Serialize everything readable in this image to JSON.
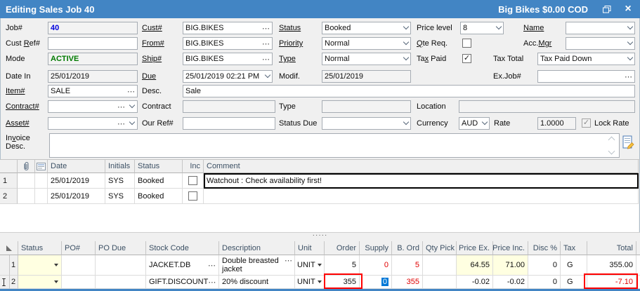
{
  "titlebar": {
    "title": "Editing Sales Job 40",
    "right_text": "Big Bikes $0.00 COD"
  },
  "icons": {
    "close": "×",
    "ellipsis": "⋯",
    "splitter_dots": "·····",
    "check": "✓"
  },
  "labels": {
    "job": {
      "pre": "Job#",
      "u": "",
      "post": ""
    },
    "cust_ref": {
      "pre": "Cust ",
      "u": "R",
      "post": "ef#"
    },
    "mode": {
      "pre": "Mode",
      "u": "",
      "post": ""
    },
    "date_in": {
      "pre": "Date In",
      "u": "",
      "post": ""
    },
    "item": {
      "pre": "",
      "u": "Item#",
      "post": ""
    },
    "cust": {
      "pre": "",
      "u": "Cust#",
      "post": ""
    },
    "from": {
      "pre": "",
      "u": "From#",
      "post": ""
    },
    "ship": {
      "pre": "",
      "u": "Ship#",
      "post": ""
    },
    "due": {
      "pre": "",
      "u": "Due",
      "post": ""
    },
    "desc": {
      "pre": "Desc.",
      "u": "",
      "post": ""
    },
    "status": {
      "pre": "",
      "u": "Status",
      "post": ""
    },
    "priority": {
      "pre": "",
      "u": "Priority",
      "post": ""
    },
    "type": {
      "pre": "",
      "u": "Type",
      "post": ""
    },
    "modif": {
      "pre": "Modif.",
      "u": "",
      "post": ""
    },
    "price_level": {
      "pre": "Price level",
      "u": "",
      "post": ""
    },
    "qte_req": {
      "pre": "",
      "u": "Q",
      "post": "te Req."
    },
    "tax_paid": {
      "pre": "Ta",
      "u": "x",
      "post": " Paid"
    },
    "name": {
      "pre": "",
      "u": "Name",
      "post": ""
    },
    "acc_mgr": {
      "pre": "Acc.",
      "u": "Mgr",
      "post": ""
    },
    "tax_total": {
      "pre": "Tax Total",
      "u": "",
      "post": ""
    },
    "ex_job": {
      "pre": "Ex.Job#",
      "u": "",
      "post": ""
    },
    "contract_no": {
      "pre": "",
      "u": "Contract#",
      "post": ""
    },
    "contract": {
      "pre": "Contract",
      "u": "",
      "post": ""
    },
    "type2": {
      "pre": "Type",
      "u": "",
      "post": ""
    },
    "location": {
      "pre": "Location",
      "u": "",
      "post": ""
    },
    "asset": {
      "pre": "",
      "u": "Asset#",
      "post": ""
    },
    "our_ref": {
      "pre": "Our Ref#",
      "u": "",
      "post": ""
    },
    "status_due": {
      "pre": "Status Due",
      "u": "",
      "post": ""
    },
    "currency": {
      "pre": "Currency",
      "u": "",
      "post": ""
    },
    "rate": {
      "pre": "Rate",
      "u": "",
      "post": ""
    },
    "lock_rate": {
      "pre": "Lock Rate",
      "u": "",
      "post": ""
    },
    "invoice_line1": {
      "pre": "In",
      "u": "v",
      "post": "oice"
    },
    "invoice_line2": {
      "pre": "Desc.",
      "u": "",
      "post": ""
    }
  },
  "values": {
    "job": "40",
    "cust_ref": "",
    "mode": "ACTIVE",
    "date_in": "25/01/2019",
    "item": "SALE",
    "cust": "BIG.BIKES",
    "from": "BIG.BIKES",
    "ship": "BIG.BIKES",
    "due": "25/01/2019 02:21 PM",
    "desc": "Sale",
    "status": "Booked",
    "priority": "Normal",
    "type": "Normal",
    "modif": "25/01/2019",
    "price_level": "8",
    "name": "",
    "acc_mgr": "",
    "tax_total": "Tax Paid Down",
    "ex_job": "",
    "contract_no": "",
    "contract": "",
    "type2": "",
    "location": "",
    "asset": "",
    "our_ref": "",
    "status_due": "",
    "currency": "AUD",
    "rate": "1.0000",
    "invoice_desc": ""
  },
  "checks": {
    "qte_req": "",
    "tax_paid": "✓",
    "lock_rate": "✓",
    "inc_1": "",
    "inc_2": ""
  },
  "comments_grid": {
    "headers": {
      "date": "Date",
      "initials": "Initials",
      "status": "Status",
      "inc": "Inc",
      "comment": "Comment"
    },
    "rows": [
      {
        "num": "1",
        "date": "25/01/2019",
        "initials": "SYS",
        "status": "Booked",
        "comment": "Watchout : Check availability first!"
      },
      {
        "num": "2",
        "date": "25/01/2019",
        "initials": "SYS",
        "status": "Booked",
        "comment": ""
      }
    ]
  },
  "items_grid": {
    "headers": {
      "status": "Status",
      "po": "PO#",
      "po_due": "PO Due",
      "stock_code": "Stock Code",
      "description": "Description",
      "unit": "Unit",
      "order": "Order",
      "supply": "Supply",
      "b_ord": "B. Ord",
      "qty_pick": "Qty Pick",
      "price_ex": "Price Ex.",
      "price_inc": "Price Inc.",
      "disc": "Disc %",
      "tax": "Tax",
      "total": "Total"
    },
    "rows": [
      {
        "num": "1",
        "stock_code": "JACKET.DB",
        "description": "Double breasted jacket",
        "unit": "UNIT",
        "order": "5",
        "supply": "0",
        "b_ord": "5",
        "qty_pick": "",
        "price_ex": "64.55",
        "price_inc": "71.00",
        "disc": "0",
        "tax": "G",
        "total": "355.00"
      },
      {
        "num": "2",
        "stock_code": "GIFT.DISCOUNT",
        "description": "20% discount",
        "unit": "UNIT",
        "order": "355",
        "supply": "0",
        "b_ord": "355",
        "qty_pick": "",
        "price_ex": "-0.02",
        "price_inc": "-0.02",
        "disc": "0",
        "tax": "G",
        "total": "-7.10"
      }
    ]
  }
}
